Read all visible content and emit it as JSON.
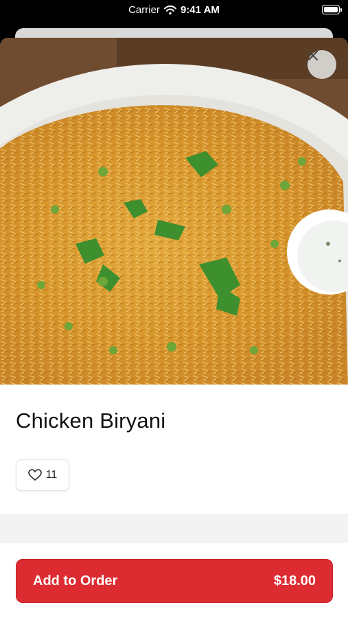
{
  "status_bar": {
    "carrier": "Carrier",
    "time": "9:41 AM",
    "icons": [
      "wifi-icon",
      "battery-icon"
    ]
  },
  "item": {
    "image_alt": "food-photo",
    "name": "Chicken Biryani",
    "likes": "11"
  },
  "buttons": {
    "close_icon": "close-icon",
    "add_to_order_label": "Add to Order",
    "price": "$18.00"
  },
  "colors": {
    "accent": "#dc2b31",
    "sheet": "#ffffff",
    "band": "#f3f3f3"
  }
}
